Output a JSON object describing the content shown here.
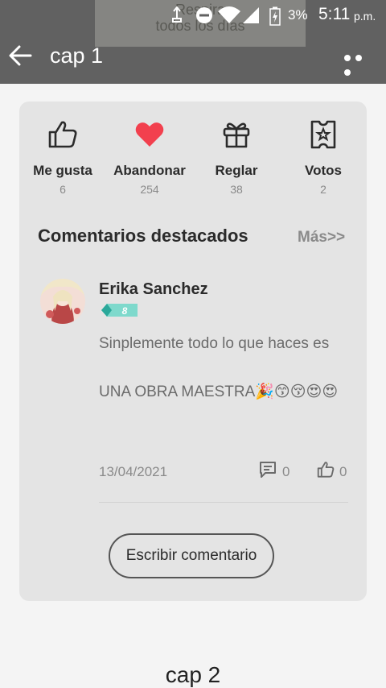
{
  "background_banner": {
    "line1": "Respira",
    "line2": "todos los días"
  },
  "status_bar": {
    "battery": "3%",
    "time": "5:11",
    "ampm": "p.m."
  },
  "header": {
    "title": "cap 1"
  },
  "actions": [
    {
      "label": "Me gusta",
      "count": "6",
      "icon": "thumbs-up-icon"
    },
    {
      "label": "Abandonar",
      "count": "254",
      "icon": "heart-icon"
    },
    {
      "label": "Reglar",
      "count": "38",
      "icon": "gift-icon"
    },
    {
      "label": "Votos",
      "count": "2",
      "icon": "vote-ticket-icon"
    }
  ],
  "featured": {
    "title": "Comentarios destacados",
    "more": "Más>>",
    "comment": {
      "user": "Erika Sanchez",
      "level": "8",
      "text_line1": "Sinplemente todo lo que haces es",
      "text_line2": "UNA OBRA MAESTRA🎉😙😚😍😍",
      "date": "13/04/2021",
      "replies": "0",
      "likes": "0"
    },
    "write_button": "Escribir comentario"
  },
  "next_chapter": "cap 2",
  "colors": {
    "topbar": "#616161",
    "card": "#e4e4e4",
    "heart": "#f2404e",
    "badge": "#3fc5b6"
  }
}
